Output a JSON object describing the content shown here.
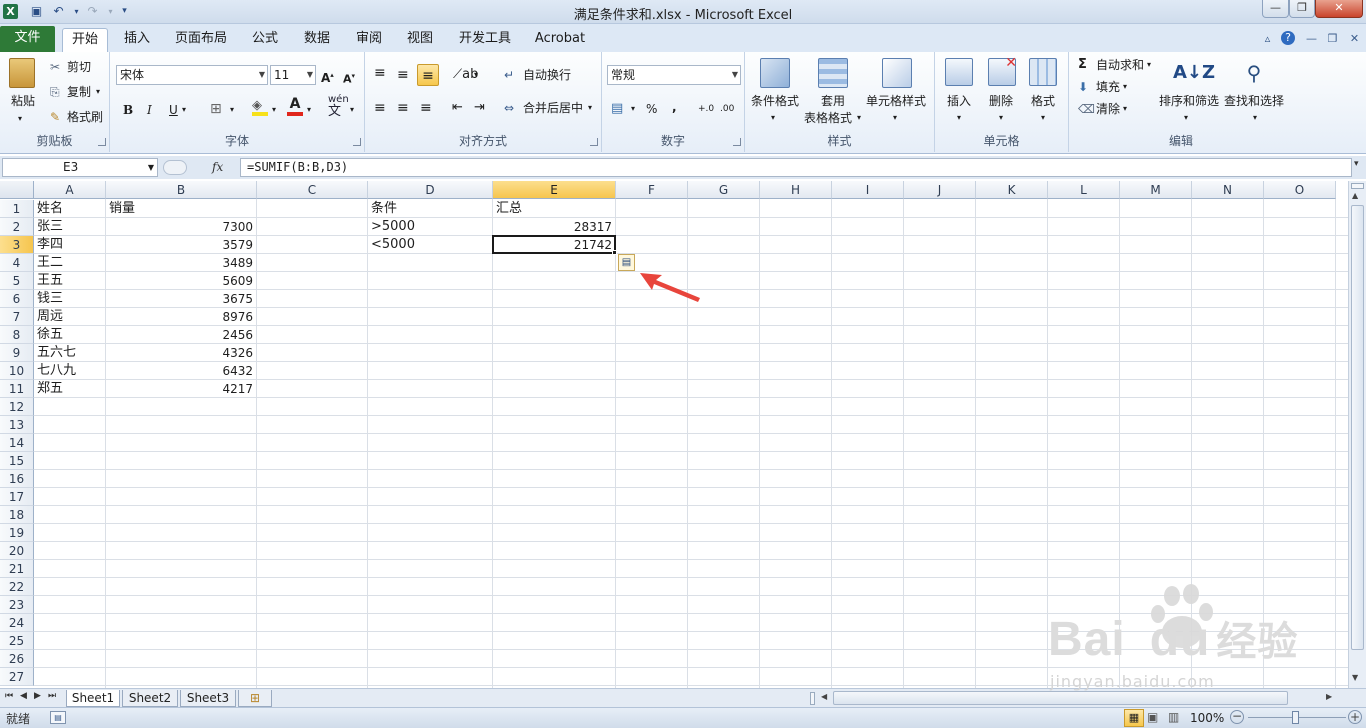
{
  "window": {
    "title": "满足条件求和.xlsx - Microsoft Excel"
  },
  "tabs": [
    {
      "label": "文件"
    },
    {
      "label": "开始"
    },
    {
      "label": "插入"
    },
    {
      "label": "页面布局"
    },
    {
      "label": "公式"
    },
    {
      "label": "数据"
    },
    {
      "label": "审阅"
    },
    {
      "label": "视图"
    },
    {
      "label": "开发工具"
    },
    {
      "label": "Acrobat"
    }
  ],
  "ribbon": {
    "clipboard": {
      "label": "剪贴板",
      "paste": "粘贴",
      "cut": "剪切",
      "copy": "复制",
      "format_painter": "格式刷"
    },
    "font": {
      "label": "字体",
      "name": "宋体",
      "size": "11",
      "bold": "B",
      "italic": "I",
      "underline": "U",
      "wen": "wén",
      "wen2": "文"
    },
    "align": {
      "label": "对齐方式",
      "wrap": "自动换行",
      "merge": "合并后居中"
    },
    "number": {
      "label": "数字",
      "format": "常规",
      "percent": "%",
      "comma": ","
    },
    "styles": {
      "label": "样式",
      "conditional": "条件格式",
      "table1": "套用",
      "table2": "表格格式",
      "cell_styles": "单元格样式"
    },
    "cells": {
      "label": "单元格",
      "insert": "插入",
      "delete": "删除",
      "format": "格式"
    },
    "editing": {
      "label": "编辑",
      "autosum": "自动求和",
      "fill": "填充",
      "clear": "清除",
      "sort": "排序和筛选",
      "find": "查找和选择"
    }
  },
  "formula_bar": {
    "name_box": "E3",
    "fx": "fx",
    "formula": "=SUMIF(B:B,D3)"
  },
  "columns": [
    "A",
    "B",
    "C",
    "D",
    "E",
    "F",
    "G",
    "H",
    "I",
    "J",
    "K",
    "L",
    "M",
    "N",
    "O"
  ],
  "rows": [
    "1",
    "2",
    "3",
    "4",
    "5",
    "6",
    "7",
    "8",
    "9",
    "10",
    "11",
    "12",
    "13",
    "14",
    "15",
    "16",
    "17",
    "18",
    "19",
    "20",
    "21",
    "22",
    "23",
    "24",
    "25",
    "26",
    "27"
  ],
  "cells": {
    "A1": "姓名",
    "B1": "销量",
    "D1": "条件",
    "E1": "汇总",
    "A2": "张三",
    "B2": "7300",
    "D2": ">5000",
    "E2": "28317",
    "A3": "李四",
    "B3": "3579",
    "D3": "<5000",
    "E3": "21742",
    "A4": "王二",
    "B4": "3489",
    "A5": "王五",
    "B5": "5609",
    "A6": "钱三",
    "B6": "3675",
    "A7": "周远",
    "B7": "8976",
    "A8": "徐五",
    "B8": "2456",
    "A9": "五六七",
    "B9": "4326",
    "A10": "七八九",
    "B10": "6432",
    "A11": "郑五",
    "B11": "4217"
  },
  "sheets": [
    "Sheet1",
    "Sheet2",
    "Sheet3"
  ],
  "status": {
    "mode": "就绪",
    "zoom": "100%"
  },
  "watermark": {
    "brand": "Bai",
    "brand2": "du",
    "cn": "经验",
    "url": "jingyan.baidu.com"
  },
  "colors": {
    "selected_header": "#f6c54e",
    "file_tab": "#2e7a37",
    "arrow": "#e8453c"
  }
}
